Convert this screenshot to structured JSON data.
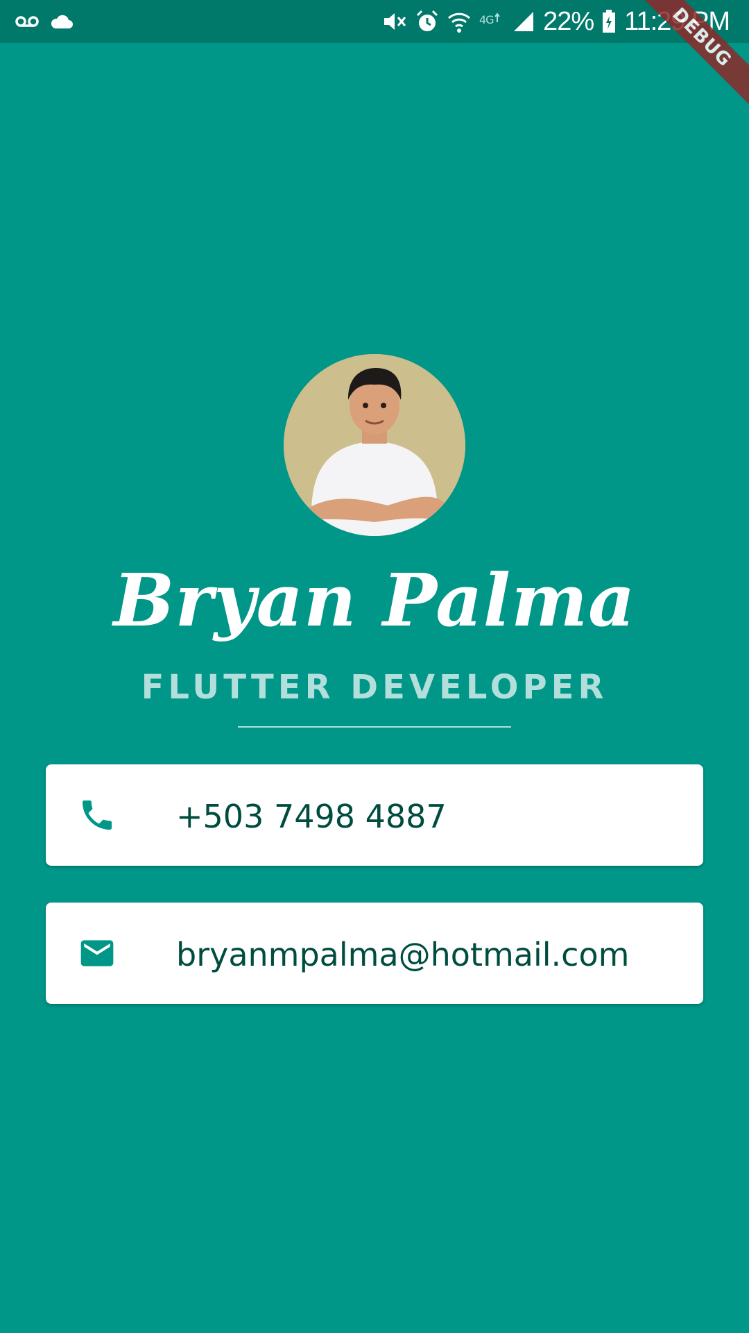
{
  "status_bar": {
    "battery": "22%",
    "time": "11:29 PM"
  },
  "debug_banner": "DEBUG",
  "profile": {
    "name": "Bryan Palma",
    "title": "FLUTTER DEVELOPER"
  },
  "contacts": {
    "phone": "+503 7498 4887",
    "email": "bryanmpalma@hotmail.com"
  },
  "colors": {
    "background": "#009688",
    "status_bar": "#00796B",
    "card": "#FFFFFF",
    "card_text": "#004D40",
    "subtitle": "#B2DFDB",
    "icon": "#009688"
  },
  "icons": {
    "status_left": [
      "voicemail-icon",
      "cloud-icon"
    ],
    "status_right": [
      "mute-icon",
      "alarm-icon",
      "wifi-icon",
      "lte-icon",
      "signal-icon",
      "battery-icon"
    ],
    "contacts": [
      "phone-icon",
      "mail-icon"
    ]
  }
}
